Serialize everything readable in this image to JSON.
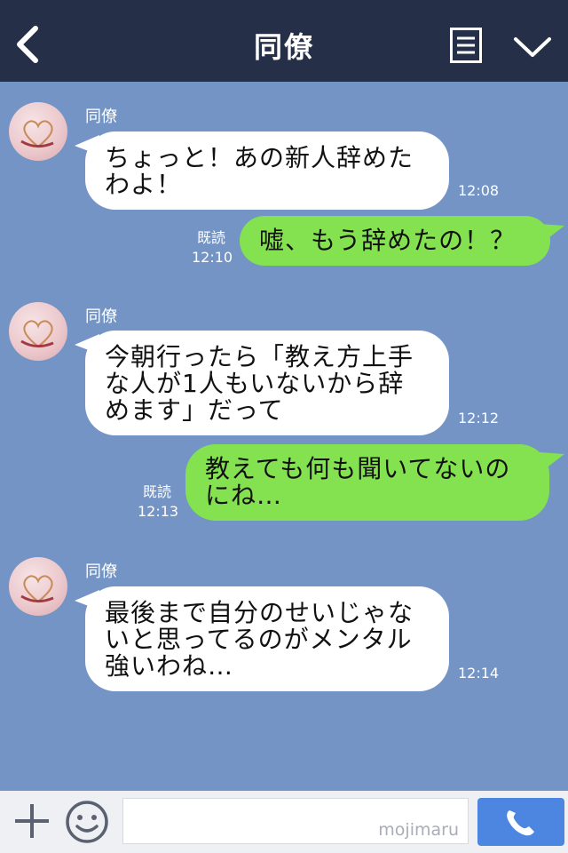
{
  "header": {
    "title": "同僚"
  },
  "colors": {
    "header_bg": "#252f48",
    "chat_bg": "#7394c4",
    "incoming": "#ffffff",
    "outgoing": "#84e251",
    "send_button": "#4d86e0"
  },
  "messages": [
    {
      "direction": "in",
      "sender": "同僚",
      "lines": [
        "ちょっと！あの新人辞めた",
        "わよ！"
      ],
      "time": "12:08"
    },
    {
      "direction": "out",
      "read": "既読",
      "lines": [
        "嘘、もう辞めたの！？"
      ],
      "time": "12:10"
    },
    {
      "direction": "in",
      "sender": "同僚",
      "lines": [
        "今朝行ったら「教え方上手",
        "な人が1人もいないから辞",
        "めます」だって"
      ],
      "time": "12:12"
    },
    {
      "direction": "out",
      "read": "既読",
      "lines": [
        "教えても何も聞いてないの",
        "にね…"
      ],
      "time": "12:13"
    },
    {
      "direction": "in",
      "sender": "同僚",
      "lines": [
        "最後まで自分のせいじゃな",
        "いと思ってるのがメンタル",
        "強いわね…"
      ],
      "time": "12:14"
    }
  ],
  "input": {
    "watermark": "mojimaru"
  },
  "icons": {
    "back": "chevron-left-icon",
    "menu": "menu-icon",
    "collapse": "chevron-down-icon",
    "add": "plus-icon",
    "sticker": "smiley-icon",
    "call": "phone-icon"
  }
}
